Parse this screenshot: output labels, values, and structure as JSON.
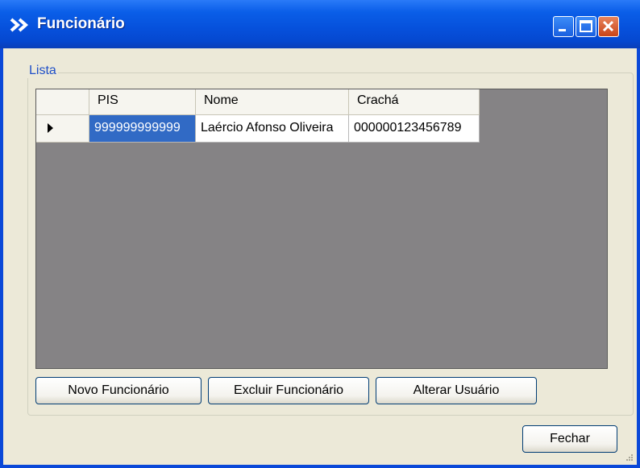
{
  "window": {
    "title": "Funcionário",
    "controls": [
      "minimize-icon",
      "maximize-icon",
      "close-icon"
    ]
  },
  "group": {
    "label": "Lista"
  },
  "grid": {
    "columns": [
      "PIS",
      "Nome",
      "Crachá"
    ],
    "rows": [
      {
        "cells": [
          "999999999999",
          "Laércio Afonso Oliveira",
          "000000123456789"
        ],
        "current": true
      }
    ],
    "row_indicator": "current-row-arrow-icon"
  },
  "buttons": {
    "novo": "Novo Funcionário",
    "excluir": "Excluir Funcionário",
    "alterar": "Alterar Usuário",
    "fechar": "Fechar"
  },
  "colors": {
    "title_bar": "#0650db",
    "client_bg": "#ece9d8",
    "grid_bg": "#858385",
    "selection": "#316ac5",
    "group_label": "#2050c8"
  }
}
